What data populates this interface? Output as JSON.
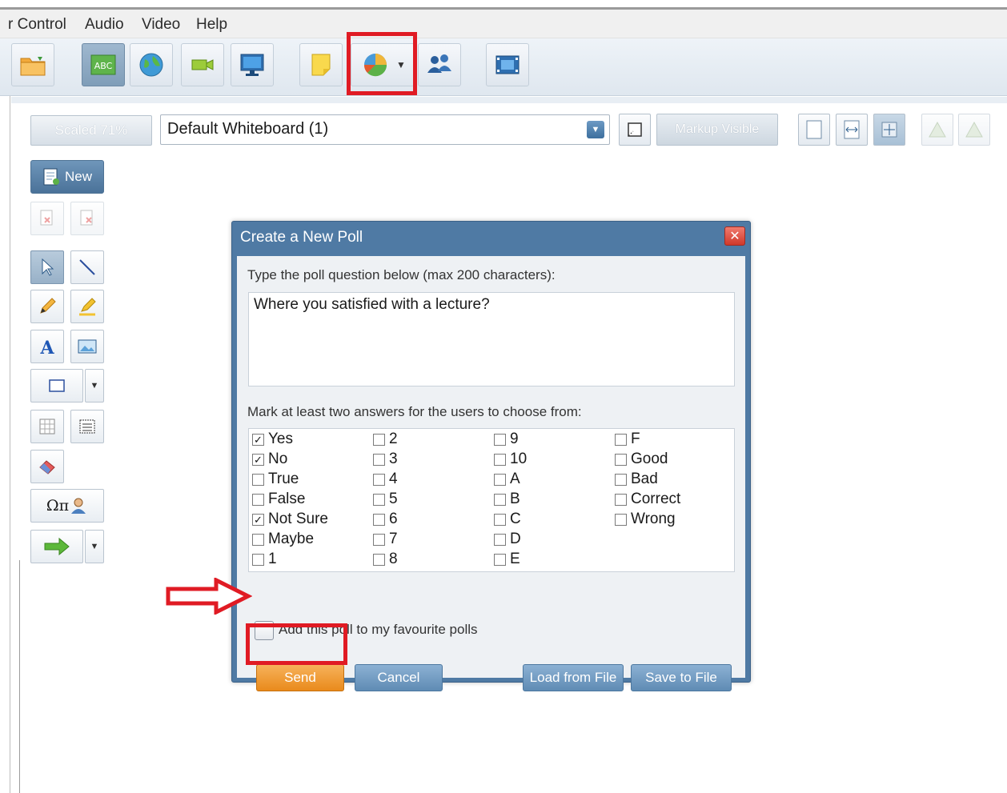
{
  "menu": {
    "items": [
      "r Control",
      "Audio",
      "Video",
      "Help"
    ]
  },
  "whiteboard": {
    "scaled_label": "Scaled 71%",
    "name": "Default Whiteboard (1)",
    "markup_label": "Markup Visible",
    "new_label": "New"
  },
  "tools": {
    "symbols_label": "Ωπ"
  },
  "dialog": {
    "title": "Create a New Poll",
    "question_prompt": "Type the poll question below (max 200 characters):",
    "question_value": "Where you satisfied with a lecture?",
    "answers_prompt": "Mark at least two answers for the users to choose from:",
    "answers": [
      {
        "label": "Yes",
        "checked": true
      },
      {
        "label": "No",
        "checked": true
      },
      {
        "label": "True",
        "checked": false
      },
      {
        "label": "False",
        "checked": false
      },
      {
        "label": "Not Sure",
        "checked": true
      },
      {
        "label": "Maybe",
        "checked": false
      },
      {
        "label": "1",
        "checked": false
      },
      {
        "label": "2",
        "checked": false
      },
      {
        "label": "3",
        "checked": false
      },
      {
        "label": "4",
        "checked": false
      },
      {
        "label": "5",
        "checked": false
      },
      {
        "label": "6",
        "checked": false
      },
      {
        "label": "7",
        "checked": false
      },
      {
        "label": "8",
        "checked": false
      },
      {
        "label": "9",
        "checked": false
      },
      {
        "label": "10",
        "checked": false
      },
      {
        "label": "A",
        "checked": false
      },
      {
        "label": "B",
        "checked": false
      },
      {
        "label": "C",
        "checked": false
      },
      {
        "label": "D",
        "checked": false
      },
      {
        "label": "E",
        "checked": false
      },
      {
        "label": "F",
        "checked": false
      },
      {
        "label": "Good",
        "checked": false
      },
      {
        "label": "Bad",
        "checked": false
      },
      {
        "label": "Correct",
        "checked": false
      },
      {
        "label": "Wrong",
        "checked": false
      }
    ],
    "favourite_label": "Add this poll to my favourite polls",
    "favourite_checked": false,
    "buttons": {
      "send": "Send",
      "cancel": "Cancel",
      "load": "Load from File",
      "save": "Save to File"
    }
  },
  "colors": {
    "dialog_header": "#4f7aa4",
    "highlight_red": "#e01b24",
    "send_orange": "#e98a1c"
  }
}
